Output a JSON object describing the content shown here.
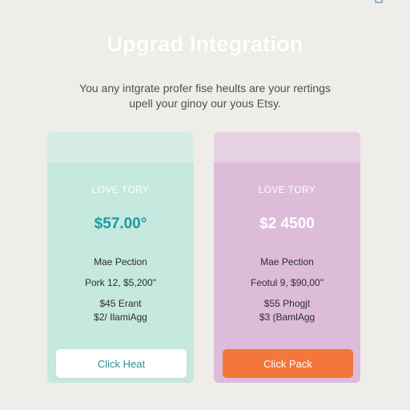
{
  "header": {
    "title": "Upgrad Integration",
    "subtitle_lines": [
      "You any intgrate profer fise heults are your rertings",
      "upell your ginoy our yous Etsy."
    ]
  },
  "plans": [
    {
      "label": "LOVE TORY",
      "price": "$57.00°",
      "plan_name": "Mae Pection",
      "details": [
        "Pork 12, $5,200\"",
        "$45 Erant",
        "$2/ IlamiAgg"
      ],
      "button_label": "Click Heat",
      "accent_color": "#1d9aa0",
      "card_color": "#c5e8df"
    },
    {
      "label": "LOVE TORY",
      "price": "$2 4500",
      "plan_name": "Mae Pection",
      "details": [
        "Feotul 9, $90,00\"",
        "$55 Phogjt",
        "$3 (BamlAgg"
      ],
      "button_label": "Click Pack",
      "accent_color": "#f4763a",
      "card_color": "#dcbcd9"
    }
  ]
}
